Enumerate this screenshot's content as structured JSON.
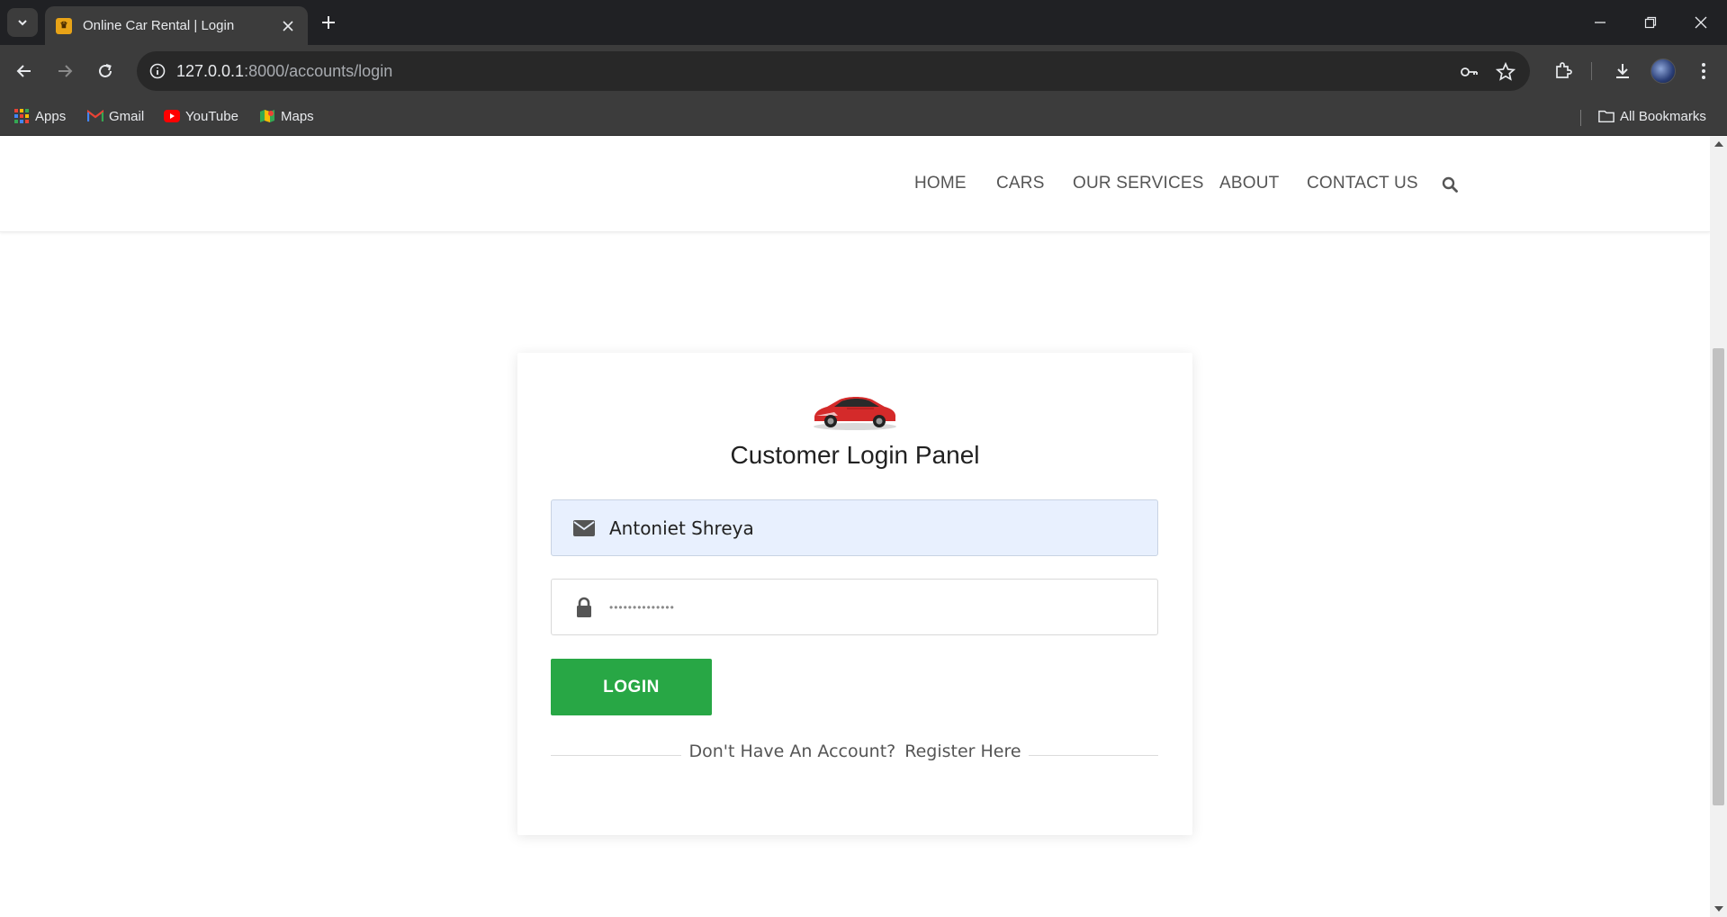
{
  "browser": {
    "tab_title": "Online Car Rental | Login",
    "url_host": "127.0.0.1",
    "url_rest": ":8000/accounts/login",
    "bookmarks": [
      "Apps",
      "Gmail",
      "YouTube",
      "Maps"
    ],
    "all_bookmarks": "All Bookmarks"
  },
  "nav": {
    "home": "HOME",
    "cars": "CARS",
    "services": "OUR SERVICES",
    "about": "ABOUT",
    "contact": "CONTACT US"
  },
  "login": {
    "title": "Customer Login Panel",
    "email_value": "Antoniet Shreya",
    "password_mask": "••••••••••••••",
    "button": "LOGIN",
    "no_account": "Don't Have An Account?",
    "register": "Register Here"
  },
  "colors": {
    "login_button": "#28a745",
    "autofill_bg": "#e8f0fe"
  }
}
